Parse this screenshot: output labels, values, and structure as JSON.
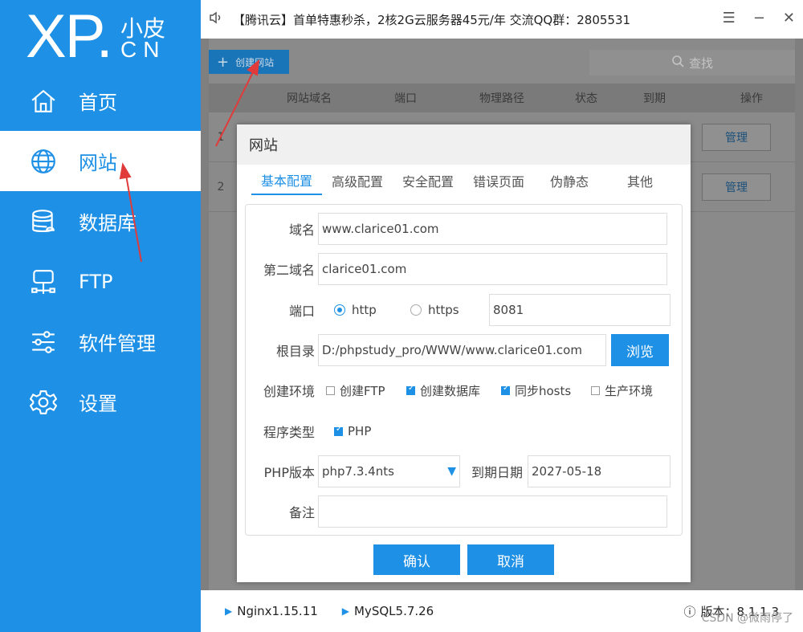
{
  "sidebar": {
    "logo_xp": "XP.",
    "logo_cn1": "小皮",
    "logo_cn2": "CN",
    "items": [
      {
        "label": "首页",
        "icon": "home-icon"
      },
      {
        "label": "网站",
        "icon": "globe-icon",
        "active": true
      },
      {
        "label": "数据库",
        "icon": "database-icon"
      },
      {
        "label": "FTP",
        "icon": "ftp-icon"
      },
      {
        "label": "软件管理",
        "icon": "sliders-icon"
      },
      {
        "label": "设置",
        "icon": "gear-icon"
      }
    ]
  },
  "topbar": {
    "announcement": "【腾讯云】首单特惠秒杀，2核2G云服务器45元/年 交流QQ群：2805531",
    "menu": "☰",
    "minimize": "−",
    "close": "✕"
  },
  "toolbar": {
    "create_label": "创建网站",
    "search_label": "查找"
  },
  "table": {
    "headers": [
      "网站域名",
      "端口",
      "物理路径",
      "状态",
      "到期",
      "操作"
    ],
    "rows": [
      {
        "num": "1",
        "action": "管理"
      },
      {
        "num": "2",
        "action": "管理"
      }
    ]
  },
  "dialog": {
    "title": "网站",
    "tabs": [
      "基本配置",
      "高级配置",
      "安全配置",
      "错误页面",
      "伪静态",
      "其他"
    ],
    "fields": {
      "domain_label": "域名",
      "domain_value": "www.clarice01.com",
      "domain2_label": "第二域名",
      "domain2_value": "clarice01.com",
      "port_label": "端口",
      "http_label": "http",
      "https_label": "https",
      "port_value": "8081",
      "root_label": "根目录",
      "root_value": "D:/phpstudy_pro/WWW/www.clarice01.com",
      "browse_label": "浏览",
      "env_label": "创建环境",
      "env_options": [
        {
          "label": "创建FTP",
          "checked": false
        },
        {
          "label": "创建数据库",
          "checked": true
        },
        {
          "label": "同步hosts",
          "checked": true
        },
        {
          "label": "生产环境",
          "checked": false
        }
      ],
      "type_label": "程序类型",
      "type_option": "PHP",
      "php_label": "PHP版本",
      "php_value": "php7.3.4nts",
      "expire_label": "到期日期",
      "expire_value": "2027-05-18",
      "note_label": "备注",
      "note_value": ""
    },
    "ok_label": "确认",
    "cancel_label": "取消"
  },
  "statusbar": {
    "nginx": "Nginx1.15.11",
    "mysql": "MySQL5.7.26",
    "version": "版本：8.1.1.3"
  },
  "watermark": "CSDN @微雨停了",
  "colors": {
    "accent": "#1e90e6",
    "arrow": "#e03a3a"
  }
}
